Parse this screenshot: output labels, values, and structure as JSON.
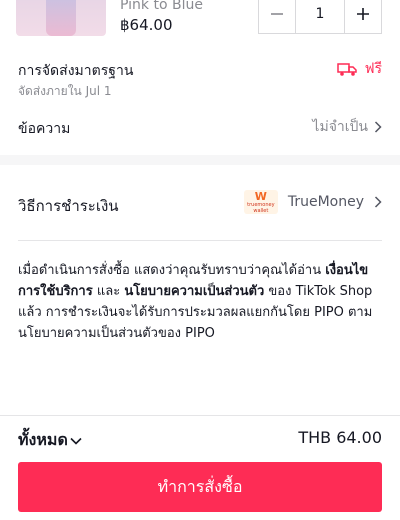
{
  "product": {
    "variant": "Pink to Blue",
    "price": "฿64.00",
    "quantity": "1",
    "icons": {
      "decrement": "minus-icon",
      "increment": "plus-icon"
    }
  },
  "shipping": {
    "title": "การจัดส่งมาตรฐาน",
    "subtitle": "จัดส่งภายใน Jul 1",
    "free_label": "ฟรี",
    "icon": "delivery-truck-icon"
  },
  "message": {
    "label": "ข้อความ",
    "value": "ไม่จำเป็น"
  },
  "payment": {
    "label": "วิธีการชำระเงิน",
    "method": "TrueMoney",
    "logo_text": "truemoney",
    "logo_sub": "wallet"
  },
  "policy": {
    "part1": "เมื่อดำเนินการสั่งซื้อ แสดงว่าคุณรับทราบว่าคุณได้อ่าน ",
    "terms_link": "เงื่อนไขการใช้บริการ",
    "part2": " และ ",
    "privacy_link": "นโยบายความเป็นส่วนตัว",
    "part3": " ของ TikTok Shop แล้ว การชำระเงินจะได้รับการประมวลผลแยกกันโดย PIPO ตาม นโยบายความเป็นส่วนตัวของ PIPO"
  },
  "footer": {
    "total_label": "ทั้งหมด",
    "total_value": "THB 64.00",
    "buy_label": "ทำการสั่งซื้อ"
  },
  "colors": {
    "accent": "#fe2c55",
    "muted": "#8a8b91",
    "text": "#161823"
  }
}
